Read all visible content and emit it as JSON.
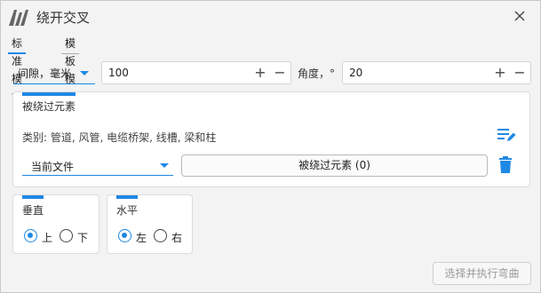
{
  "window": {
    "title": "绕开交叉"
  },
  "tabs": [
    {
      "label": "标准模式",
      "active": true
    },
    {
      "label": "模板模式",
      "active": false
    }
  ],
  "row1": {
    "mode_select": "间隙，毫米",
    "gap_value": "100",
    "angle_label": "角度，°",
    "angle_value": "20",
    "plus": "+",
    "minus": "−"
  },
  "bypass_card": {
    "title": "被绕过元素",
    "categories_text": "类别: 管道, 风管, 电缆桥架, 线槽, 梁和柱",
    "source_select": "当前文件",
    "elements_button": "被绕过元素 (0)"
  },
  "vertical_card": {
    "title": "垂直",
    "options": [
      {
        "label": "上",
        "checked": true
      },
      {
        "label": "下",
        "checked": false
      }
    ]
  },
  "horizontal_card": {
    "title": "水平",
    "options": [
      {
        "label": "左",
        "checked": true
      },
      {
        "label": "右",
        "checked": false
      }
    ]
  },
  "footer": {
    "run_button": "选择并执行弯曲"
  },
  "colors": {
    "accent": "#1e88e5",
    "background": "#f3f3f3",
    "card": "#ffffff"
  },
  "icons": [
    "app-logo-icon",
    "close-icon",
    "dropdown-caret-icon",
    "edit-list-icon",
    "trash-icon"
  ]
}
